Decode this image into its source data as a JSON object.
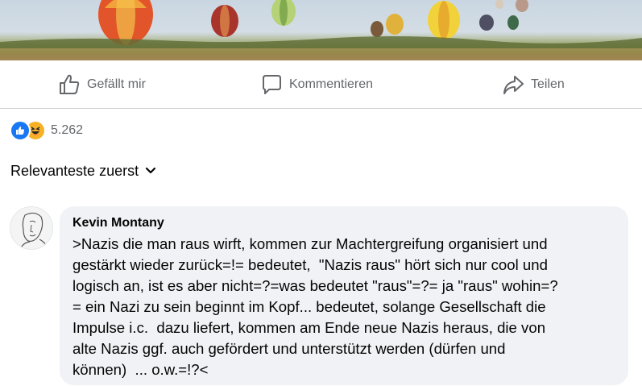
{
  "post": {
    "photo_description_icon": "hot-air-balloons-photo"
  },
  "actions": {
    "like_label": "Gefällt mir",
    "comment_label": "Kommentieren",
    "share_label": "Teilen"
  },
  "reactions": {
    "types": [
      "like",
      "haha"
    ],
    "count": "5.262"
  },
  "sort": {
    "label": "Relevanteste zuerst"
  },
  "comment": {
    "author": "Kevin Montany",
    "text": ">Nazis die man raus wirft, kommen zur Machtergreifung organisiert und\ngestärkt wieder zurück=!= bedeutet,  \"Nazis raus\" hört sich nur cool und\nlogisch an, ist es aber nicht=?=was bedeutet \"raus\"=?= ja \"raus\" wohin=?\n= ein Nazi zu sein beginnt im Kopf... bedeutet, solange Gesellschaft die\nImpulse i.c.  dazu liefert, kommen am Ende neue Nazis heraus, die von\nalte Nazis ggf. auch gefördert und unterstützt werden (dürfen und\nkönnen)  ... o.w.=!?<"
  },
  "colors": {
    "like_blue": "#1877f2",
    "haha_yellow": "#f7b125",
    "muted_text": "#65676b",
    "bubble_bg": "#f0f2f5"
  }
}
